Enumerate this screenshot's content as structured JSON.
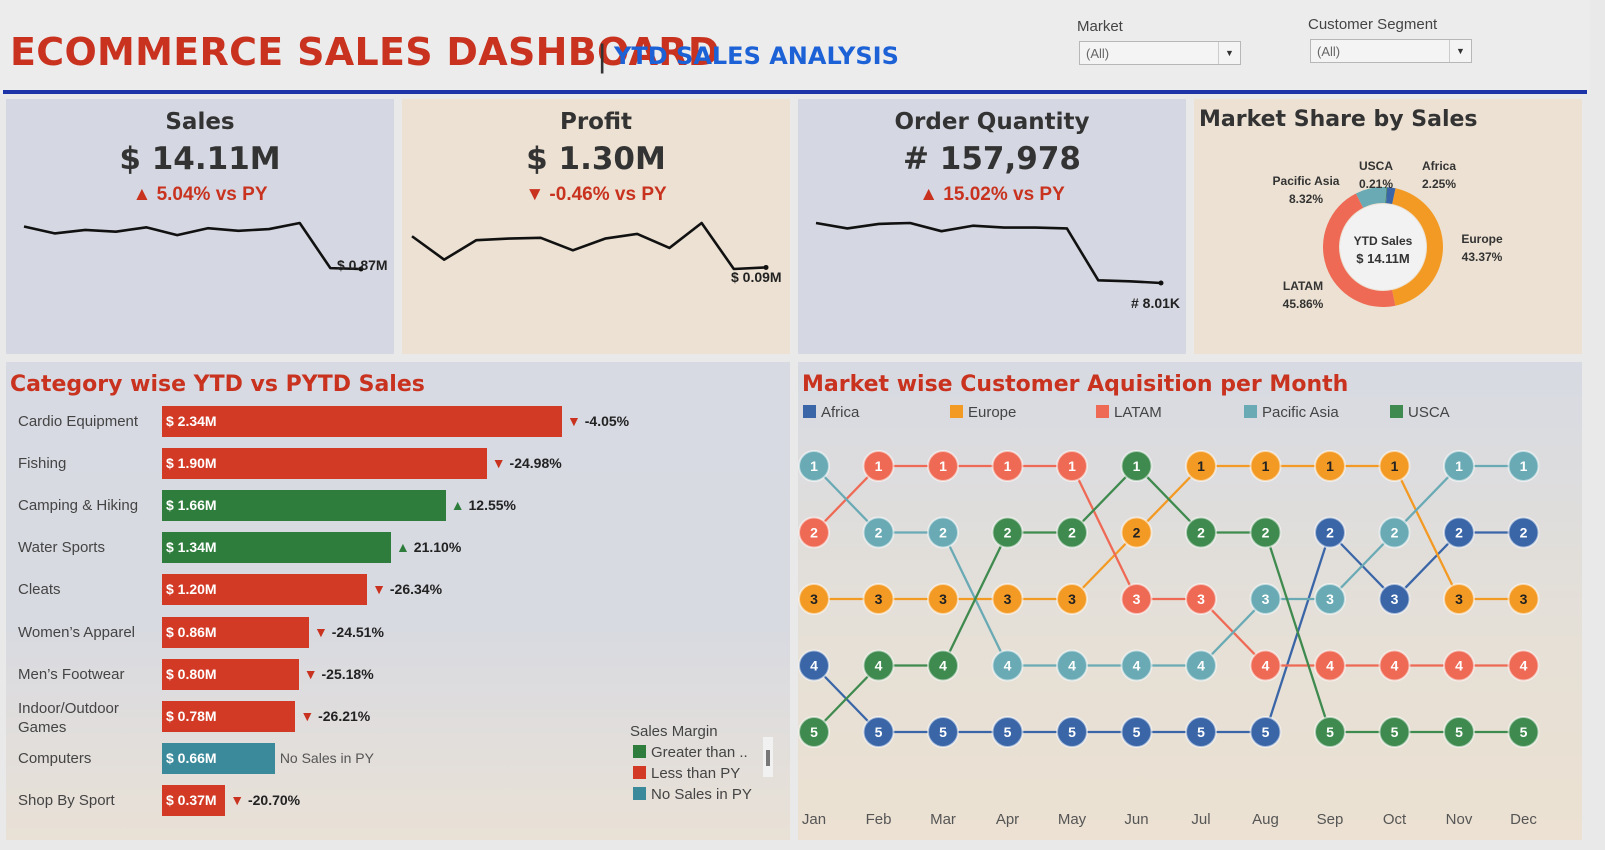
{
  "header": {
    "title": "ECOMMERCE SALES DASHBOARD",
    "separator": "|",
    "subtitle": "YTD SALES ANALYSIS"
  },
  "filters": {
    "market": {
      "label": "Market",
      "value": "(All)"
    },
    "segment": {
      "label": "Customer Segment",
      "value": "(All)"
    }
  },
  "colors": {
    "accent_red": "#c8321e",
    "accent_blue": "#1c62d6",
    "bar_red": "#d23a25",
    "bar_green": "#2e7d3c",
    "bar_teal": "#3b8a9b",
    "Africa": "#3a66a8",
    "Europe": "#f39a24",
    "LATAM": "#ee6a55",
    "Pacific Asia": "#69aab5",
    "USCA": "#3f8a4e"
  },
  "kpis": {
    "sales": {
      "title": "Sales",
      "value": "$ 14.11M",
      "delta_arrow": "▲",
      "delta": "5.04% vs PY",
      "end_label": "$ 0.87M"
    },
    "profit": {
      "title": "Profit",
      "value": "$ 1.30M",
      "delta_arrow": "▼",
      "delta": "-0.46% vs PY",
      "end_label": "$ 0.09M"
    },
    "orders": {
      "title": "Order Quantity",
      "value": "# 157,978",
      "delta_arrow": "▲",
      "delta": "15.02% vs PY",
      "end_label": "# 8.01K"
    }
  },
  "market_share": {
    "title": "Market Share by Sales",
    "center_line1": "YTD Sales",
    "center_line2": "$ 14.11M",
    "labels": {
      "pacific_name": "Pacific Asia",
      "pacific_pct": "8.32%",
      "usca_name": "USCA",
      "usca_pct": "0.21%",
      "africa_name": "Africa",
      "africa_pct": "2.25%",
      "europe_name": "Europe",
      "europe_pct": "43.37%",
      "latam_name": "LATAM",
      "latam_pct": "45.86%"
    }
  },
  "category_section": {
    "title": "Category wise YTD vs PYTD Sales",
    "legend_title": "Sales Margin",
    "legend_items": [
      "Greater than ..",
      "Less than PY",
      "No Sales in PY"
    ]
  },
  "bump_section": {
    "title": "Market wise Customer Aquisition per Month",
    "legend": [
      "Africa",
      "Europe",
      "LATAM",
      "Pacific Asia",
      "USCA"
    ]
  },
  "chart_data": [
    {
      "type": "line",
      "title": "Sales",
      "x": [
        "Jan",
        "Feb",
        "Mar",
        "Apr",
        "May",
        "Jun",
        "Jul",
        "Aug",
        "Sep",
        "Oct",
        "Nov",
        "Dec"
      ],
      "values": [
        1.36,
        1.28,
        1.32,
        1.3,
        1.35,
        1.26,
        1.34,
        1.31,
        1.33,
        1.4,
        0.88,
        0.87
      ],
      "end_label": "$ 0.87M"
    },
    {
      "type": "line",
      "title": "Profit",
      "x": [
        "Jan",
        "Feb",
        "Mar",
        "Apr",
        "May",
        "Jun",
        "Jul",
        "Aug",
        "Sep",
        "Oct",
        "Nov",
        "Dec"
      ],
      "values": [
        0.13,
        0.1,
        0.125,
        0.127,
        0.128,
        0.112,
        0.127,
        0.133,
        0.115,
        0.147,
        0.088,
        0.09
      ],
      "end_label": "$ 0.09M"
    },
    {
      "type": "line",
      "title": "Order Quantity",
      "x": [
        "Jan",
        "Feb",
        "Mar",
        "Apr",
        "May",
        "Jun",
        "Jul",
        "Aug",
        "Sep",
        "Oct",
        "Nov",
        "Dec"
      ],
      "values": [
        14.6,
        14.0,
        14.5,
        14.6,
        13.7,
        14.3,
        14.1,
        14.1,
        14.0,
        8.3,
        8.2,
        8.01
      ],
      "end_label": "# 8.01K"
    },
    {
      "type": "pie",
      "title": "Market Share by Sales",
      "categories": [
        "Europe",
        "LATAM",
        "Pacific Asia",
        "USCA",
        "Africa"
      ],
      "values": [
        43.37,
        45.86,
        8.32,
        0.21,
        2.25
      ]
    },
    {
      "type": "bar",
      "title": "Category wise YTD vs PYTD Sales",
      "categories": [
        "Cardio Equipment",
        "Fishing",
        "Camping & Hiking",
        "Water Sports",
        "Cleats",
        "Women's Apparel",
        "Men's Footwear",
        "Indoor/Outdoor Games",
        "Computers",
        "Shop By Sport"
      ],
      "category_display": [
        "Cardio Equipment",
        "Fishing",
        "Camping & Hiking",
        "Water Sports",
        "Cleats",
        "Women’s Apparel",
        "Men’s Footwear",
        "Indoor/Outdoor\nGames",
        "Computers",
        "Shop By Sport"
      ],
      "values": [
        2.34,
        1.9,
        1.66,
        1.34,
        1.2,
        0.86,
        0.8,
        0.78,
        0.66,
        0.37
      ],
      "value_labels": [
        "$ 2.34M",
        "$ 1.90M",
        "$ 1.66M",
        "$ 1.34M",
        "$ 1.20M",
        "$ 0.86M",
        "$ 0.80M",
        "$ 0.78M",
        "$ 0.66M",
        "$ 0.37M"
      ],
      "margin": [
        "less",
        "less",
        "greater",
        "greater",
        "less",
        "less",
        "less",
        "less",
        "none",
        "less"
      ],
      "delta_labels": [
        "-4.05%",
        "-24.98%",
        "12.55%",
        "21.10%",
        "-26.34%",
        "-24.51%",
        "-25.18%",
        "-26.21%",
        "No Sales in PY",
        "-20.70%"
      ]
    },
    {
      "type": "line",
      "title": "Market wise Customer Aquisition per Month",
      "x": [
        "Jan",
        "Feb",
        "Mar",
        "Apr",
        "May",
        "Jun",
        "Jul",
        "Aug",
        "Sep",
        "Oct",
        "Nov",
        "Dec"
      ],
      "ylim": [
        1,
        5
      ],
      "series": [
        {
          "name": "Africa",
          "values": [
            4,
            5,
            5,
            5,
            5,
            5,
            5,
            5,
            2,
            3,
            2,
            2
          ]
        },
        {
          "name": "Europe",
          "values": [
            3,
            3,
            3,
            3,
            3,
            2,
            1,
            1,
            1,
            1,
            3,
            3
          ]
        },
        {
          "name": "LATAM",
          "values": [
            2,
            1,
            1,
            1,
            1,
            3,
            3,
            4,
            4,
            4,
            4,
            4
          ]
        },
        {
          "name": "Pacific Asia",
          "values": [
            1,
            2,
            2,
            4,
            4,
            4,
            4,
            3,
            3,
            2,
            1,
            1
          ]
        },
        {
          "name": "USCA",
          "values": [
            5,
            4,
            4,
            2,
            2,
            1,
            2,
            2,
            5,
            5,
            5,
            5
          ]
        }
      ]
    }
  ]
}
